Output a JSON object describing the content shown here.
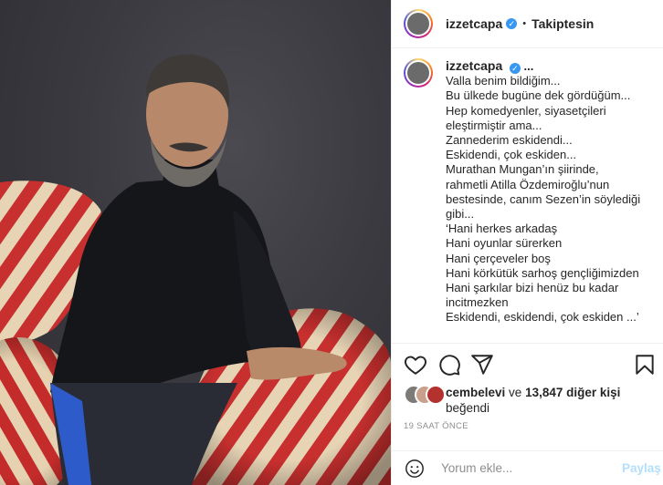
{
  "post": {
    "username": "izzetcapa",
    "verified_mark": "✓",
    "separator": "•",
    "follow_status": "Takiptesin",
    "caption_more": "...",
    "caption_lines": [
      "Valla benim bildiğim...",
      "Bu ülkede bugüne dek gördüğüm...",
      "Hep komedyenler, siyasetçileri",
      "eleştirmiştir ama...",
      "Zannederim eskidendi...",
      "Eskidendi, çok eskiden...",
      "Murathan Mungan’ın şiirinde,",
      "rahmetli Atilla Özdemiroğlu’nun",
      "bestesinde, canım Sezen’in söylediği",
      "gibi...",
      "‘Hani herkes arkadaş",
      "Hani oyunlar sürerken",
      "Hani çerçeveler boş",
      "Hani körkütük sarhoş gençliğimizden",
      "Hani şarkılar bizi henüz bu kadar",
      "incitmezken",
      "Eskidendi, eskidendi, çok eskiden ...’"
    ]
  },
  "likes": {
    "first_liker": "cembelevi",
    "connector": " ve ",
    "others": "13,847 diğer kişi",
    "suffix": "beğendi"
  },
  "timestamp": "19 SAAT ÖNCE",
  "comment": {
    "placeholder": "Yorum ekle...",
    "post_label": "Paylaş"
  },
  "icons": {
    "like": "heart-icon",
    "comment": "comment-icon",
    "share": "share-icon",
    "save": "bookmark-icon",
    "emoji": "emoji-icon"
  },
  "colors": {
    "verified": "#3897f0",
    "post_button_disabled": "#b2dffc",
    "muted_text": "#8e8e8e"
  }
}
